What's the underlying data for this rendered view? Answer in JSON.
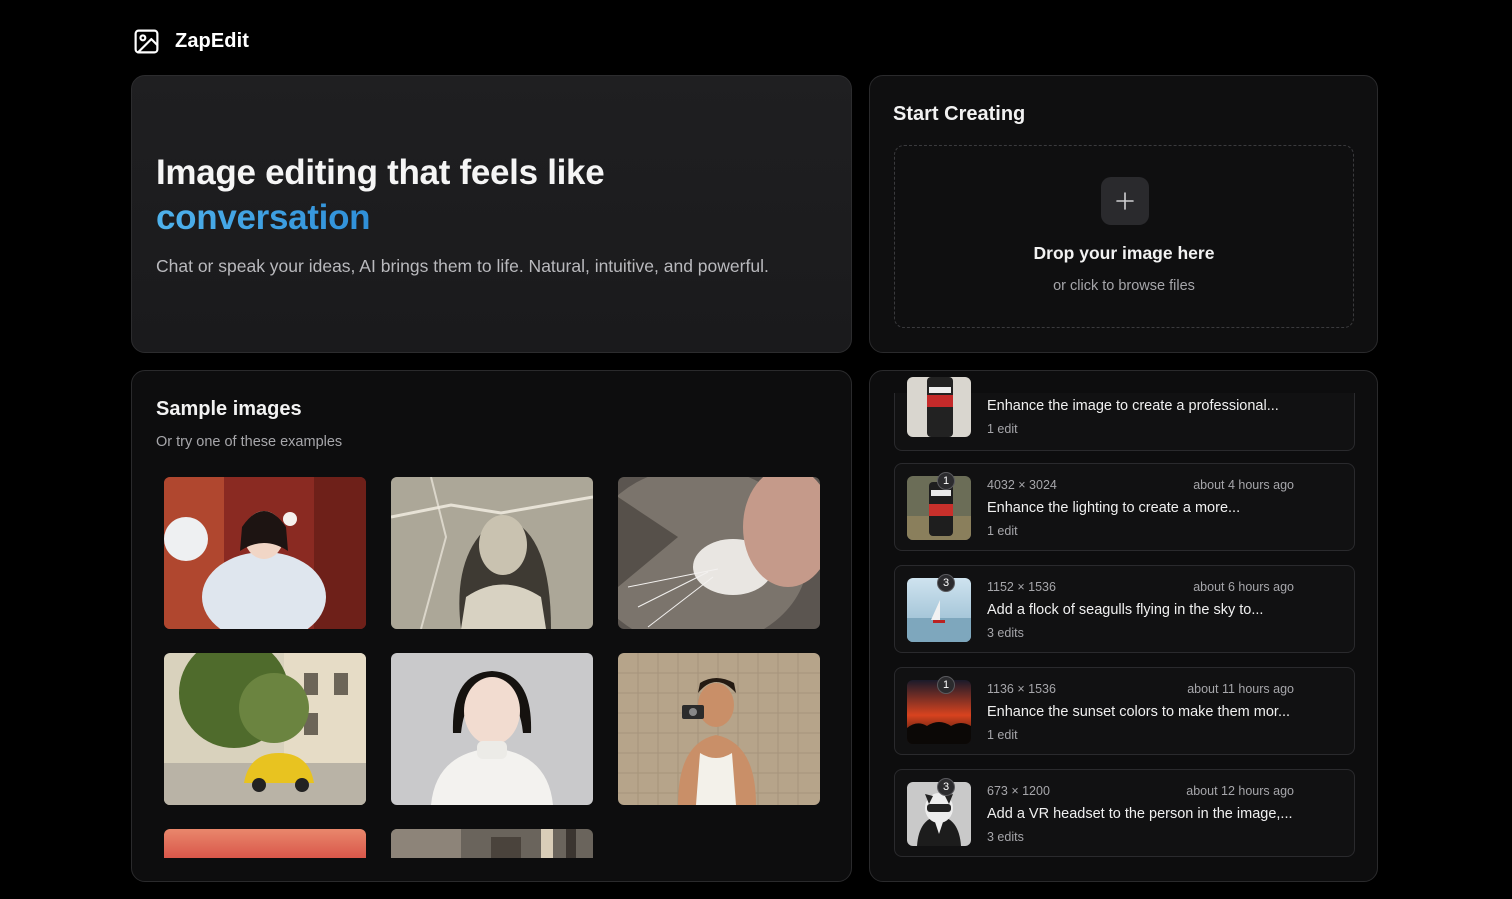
{
  "app": {
    "name": "ZapEdit",
    "logo_icon": "image-icon"
  },
  "hero": {
    "title": "Image editing that feels like",
    "accent": "conversation",
    "subtitle": "Chat or speak your ideas, AI brings them to life. Natural, intuitive, and powerful.",
    "accent_color": "#3aa6e6"
  },
  "start": {
    "title": "Start Creating",
    "drop_title": "Drop your image here",
    "drop_subtitle": "or click to browse files",
    "icon": "plus-icon"
  },
  "samples": {
    "title": "Sample images",
    "subtitle": "Or try one of these examples",
    "images": [
      {
        "name": "girl-hanfu-fan"
      },
      {
        "name": "vintage-torn-portrait"
      },
      {
        "name": "cat-closeup"
      },
      {
        "name": "yellow-car-street"
      },
      {
        "name": "woman-turtleneck-portrait"
      },
      {
        "name": "man-with-camera"
      },
      {
        "name": "sunset-gradient"
      },
      {
        "name": "city-street"
      }
    ]
  },
  "history": [
    {
      "dims": "",
      "time": "",
      "title": "Enhance the image to create a professional...",
      "edits": "1 edit",
      "badge": ""
    },
    {
      "dims": "4032 × 3024",
      "time": "about 4 hours ago",
      "title": "Enhance the lighting to create a more...",
      "edits": "1 edit",
      "badge": "1"
    },
    {
      "dims": "1152 × 1536",
      "time": "about 6 hours ago",
      "title": "Add a flock of seagulls flying in the sky to...",
      "edits": "3 edits",
      "badge": "3"
    },
    {
      "dims": "1136 × 1536",
      "time": "about 11 hours ago",
      "title": "Enhance the sunset colors to make them mor...",
      "edits": "1 edit",
      "badge": "1"
    },
    {
      "dims": "673 × 1200",
      "time": "about 12 hours ago",
      "title": "Add a VR headset to the person in the image,...",
      "edits": "3 edits",
      "badge": "3"
    }
  ]
}
